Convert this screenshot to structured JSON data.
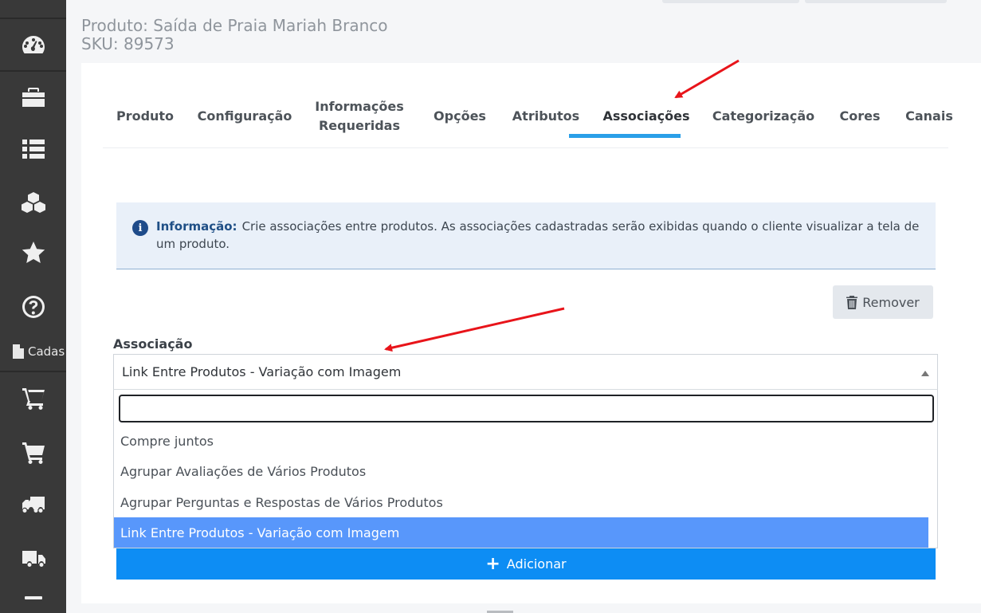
{
  "header": {
    "product_title": "Produto: Saída de Praia Mariah Branco",
    "sku": "SKU: 89573"
  },
  "sidebar": {
    "items": [
      {
        "icon": "dashboard-icon"
      },
      {
        "icon": "briefcase-icon"
      },
      {
        "icon": "list-icon"
      },
      {
        "icon": "cubes-icon"
      },
      {
        "icon": "star-icon"
      },
      {
        "icon": "help-icon"
      },
      {
        "icon": "shopping-cart-icon"
      },
      {
        "icon": "cart-icon"
      },
      {
        "icon": "truck-icon"
      },
      {
        "icon": "delivery-truck-icon"
      }
    ],
    "cadastro_label": "Cadas"
  },
  "tabs": [
    {
      "label": "Produto"
    },
    {
      "label": "Configuração"
    },
    {
      "label": "Informações Requeridas"
    },
    {
      "label": "Opções"
    },
    {
      "label": "Atributos"
    },
    {
      "label": "Associações",
      "active": true
    },
    {
      "label": "Categorização"
    },
    {
      "label": "Cores"
    },
    {
      "label": "Canais"
    }
  ],
  "info": {
    "label": "Informação:",
    "text": "Crie associações entre produtos. As associações cadastradas serão exibidas quando o cliente visualizar a tela de um produto."
  },
  "remove_button": {
    "label": "Remover"
  },
  "association": {
    "label": "Associação",
    "selected_value": "Link Entre Produtos - Variação com Imagem",
    "search_value": "",
    "options": [
      {
        "label": "Compre juntos"
      },
      {
        "label": "Agrupar Avaliações de Vários Produtos"
      },
      {
        "label": "Agrupar Perguntas e Respostas de Vários Produtos"
      },
      {
        "label": "Link Entre Produtos - Variação com Imagem",
        "selected": true
      }
    ]
  },
  "add_button": {
    "label": "Adicionar"
  },
  "colors": {
    "sidebar": "#393939",
    "active_tab_underline": "#2a9fe8",
    "primary_button": "#0d8df4",
    "selected_option": "#5897fb",
    "annotation_arrow": "#e8141a"
  }
}
